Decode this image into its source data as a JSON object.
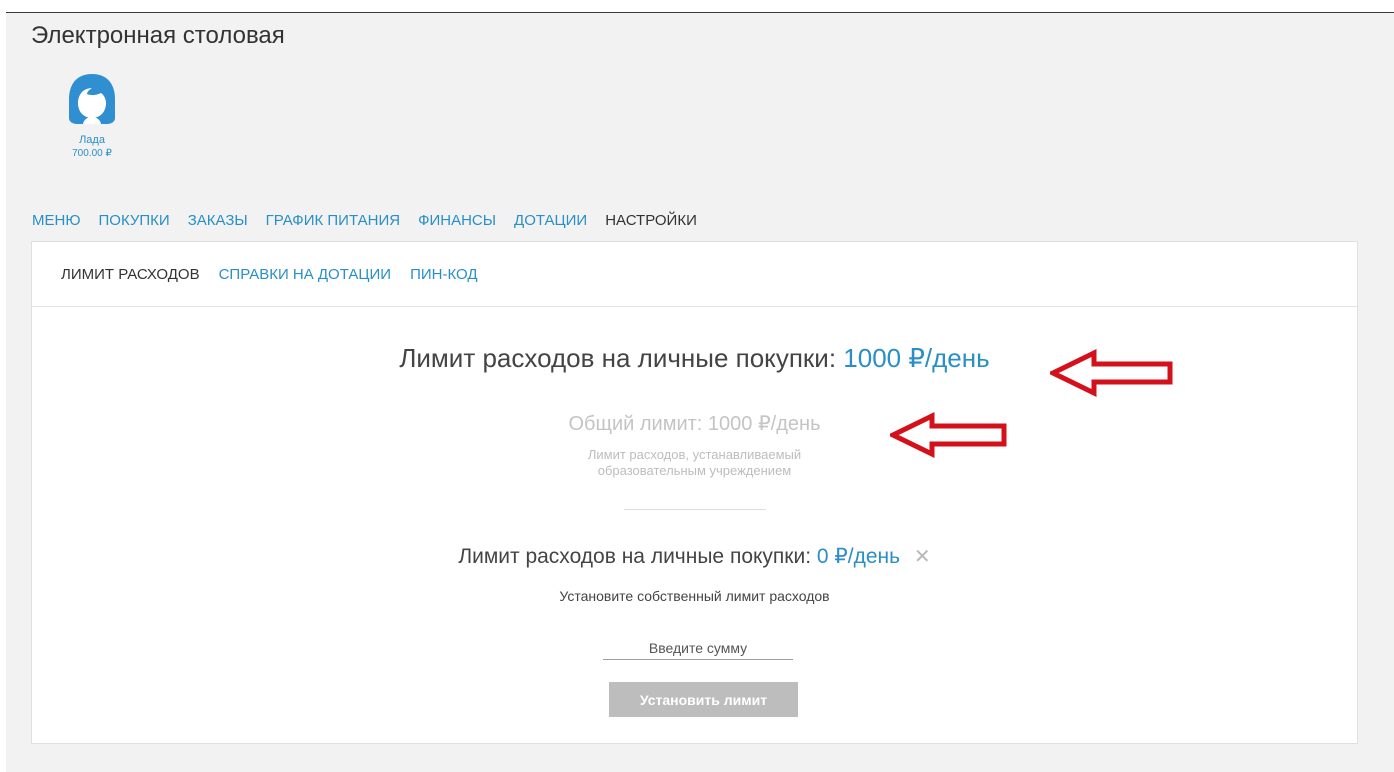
{
  "app": {
    "title": "Электронная столовая"
  },
  "child": {
    "name": "Лада",
    "balance": "700.00 ₽",
    "avatar_icon": "girl-avatar-icon"
  },
  "main_nav": {
    "items": [
      {
        "label": "МЕНЮ",
        "active": false
      },
      {
        "label": "ПОКУПКИ",
        "active": false
      },
      {
        "label": "ЗАКАЗЫ",
        "active": false
      },
      {
        "label": "ГРАФИК ПИТАНИЯ",
        "active": false
      },
      {
        "label": "ФИНАНСЫ",
        "active": false
      },
      {
        "label": "ДОТАЦИИ",
        "active": false
      },
      {
        "label": "НАСТРОЙКИ",
        "active": true
      }
    ]
  },
  "sub_nav": {
    "items": [
      {
        "label": "ЛИМИТ РАСХОДОВ",
        "active": true
      },
      {
        "label": "СПРАВКИ НА ДОТАЦИИ",
        "active": false
      },
      {
        "label": "ПИН-КОД",
        "active": false
      }
    ]
  },
  "limits": {
    "personal_label": "Лимит расходов на личные покупки:",
    "personal_value": "1000 ₽/день",
    "general_label": "Общий лимит:",
    "general_value": "1000 ₽/день",
    "general_note_line1": "Лимит расходов, устанавливаемый",
    "general_note_line2": "образовательным учреждением",
    "own_label": "Лимит расходов на личные покупки:",
    "own_value": "0 ₽/день",
    "own_hint": "Установите собственный лимит расходов"
  },
  "form": {
    "amount_placeholder": "Введите сумму",
    "amount_value": "",
    "submit_label": "Установить лимит"
  },
  "colors": {
    "accent": "#2a8fc7",
    "annotation": "#d4111b",
    "button_disabled": "#bdbdbd",
    "page_background": "#f2f2f2"
  }
}
